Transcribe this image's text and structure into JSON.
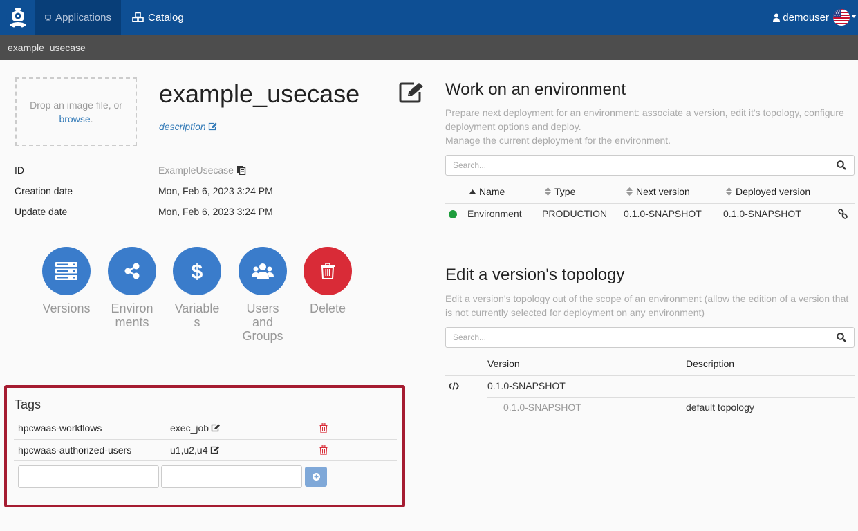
{
  "navbar": {
    "logo": "robot-logo-icon",
    "applications_label": "Applications",
    "catalog_label": "Catalog",
    "user_label": "demouser",
    "language": "us-flag-icon"
  },
  "breadcrumb": {
    "current": "example_usecase"
  },
  "app": {
    "dropzone_text": "Drop an image file, or",
    "dropzone_link": "browse",
    "dropzone_suffix": ".",
    "title": "example_usecase",
    "description_link": "description",
    "fields": {
      "id_label": "ID",
      "id_value": "ExampleUsecase",
      "creation_label": "Creation date",
      "creation_value": "Mon, Feb 6, 2023 3:24 PM",
      "update_label": "Update date",
      "update_value": "Mon, Feb 6, 2023 3:24 PM"
    }
  },
  "actions": {
    "versions": "Versions",
    "environments": "Environments",
    "variables": "Variables",
    "users_groups": "Users and Groups",
    "delete": "Delete"
  },
  "tags": {
    "title": "Tags",
    "rows": [
      {
        "key": "hpcwaas-workflows",
        "value": "exec_job"
      },
      {
        "key": "hpcwaas-authorized-users",
        "value": "u1,u2,u4"
      }
    ],
    "new_key_value": "",
    "new_value_value": ""
  },
  "environments_section": {
    "title": "Work on an environment",
    "description_line1": "Prepare next deployment for an environment: associate a version, edit it's topology, configure deployment options and deploy.",
    "description_line2": "Manage the current deployment for the environment.",
    "search_placeholder": "Search...",
    "headers": {
      "name": "Name",
      "type": "Type",
      "next_version": "Next version",
      "deployed_version": "Deployed version"
    },
    "rows": [
      {
        "status_color": "#1e9d3c",
        "name": "Environment",
        "type": "PRODUCTION",
        "next_version": "0.1.0-SNAPSHOT",
        "deployed_version": "0.1.0-SNAPSHOT"
      }
    ]
  },
  "topology_section": {
    "title": "Edit a version's topology",
    "description": "Edit a version's topology out of the scope of an environment (allow the edition of a version that is not currently selected for deployment on any environment)",
    "search_placeholder": "Search...",
    "headers": {
      "version": "Version",
      "description": "Description"
    },
    "group_version": "0.1.0-SNAPSHOT",
    "rows": [
      {
        "version": "0.1.0-SNAPSHOT",
        "description": "default topology"
      }
    ]
  },
  "colors": {
    "navbar": "#0e4f94",
    "breadcrumb": "#4d4d4d",
    "primary": "#3a7ccb",
    "danger": "#d92b37",
    "highlight_border": "#a51c31"
  }
}
